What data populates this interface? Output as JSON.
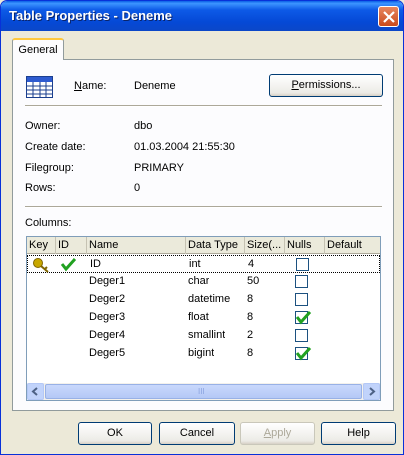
{
  "window": {
    "title": "Table Properties - Deneme",
    "close_icon": "close-icon"
  },
  "tabs": [
    {
      "label": "General",
      "active": true
    }
  ],
  "name_row": {
    "label": "Name:",
    "value": "Deneme",
    "icon": "table-icon"
  },
  "permissions_label": "Permissions...",
  "info": [
    {
      "label": "Owner:",
      "value": "dbo"
    },
    {
      "label": "Create date:",
      "value": "01.03.2004 21:55:30"
    },
    {
      "label": "Filegroup:",
      "value": "PRIMARY"
    },
    {
      "label": "Rows:",
      "value": "0"
    }
  ],
  "columns_label": "Columns:",
  "grid": {
    "headers": [
      "Key",
      "ID",
      "Name",
      "Data Type",
      "Size(...",
      "Nulls",
      "Default"
    ],
    "rows": [
      {
        "key": true,
        "id": true,
        "name": "ID",
        "type": "int",
        "size": "4",
        "nulls": false,
        "selected": true
      },
      {
        "key": false,
        "id": false,
        "name": "Deger1",
        "type": "char",
        "size": "50",
        "nulls": false
      },
      {
        "key": false,
        "id": false,
        "name": "Deger2",
        "type": "datetime",
        "size": "8",
        "nulls": false
      },
      {
        "key": false,
        "id": false,
        "name": "Deger3",
        "type": "float",
        "size": "8",
        "nulls": true
      },
      {
        "key": false,
        "id": false,
        "name": "Deger4",
        "type": "smallint",
        "size": "2",
        "nulls": false
      },
      {
        "key": false,
        "id": false,
        "name": "Deger5",
        "type": "bigint",
        "size": "8",
        "nulls": true
      }
    ],
    "scroll_thumb_glyph": "III"
  },
  "buttons": {
    "ok": "OK",
    "cancel": "Cancel",
    "apply": "Apply",
    "help": "Help"
  },
  "colors": {
    "title_bar": "#0549d6",
    "check": "#21a121",
    "key_icon": "#c8a800"
  }
}
